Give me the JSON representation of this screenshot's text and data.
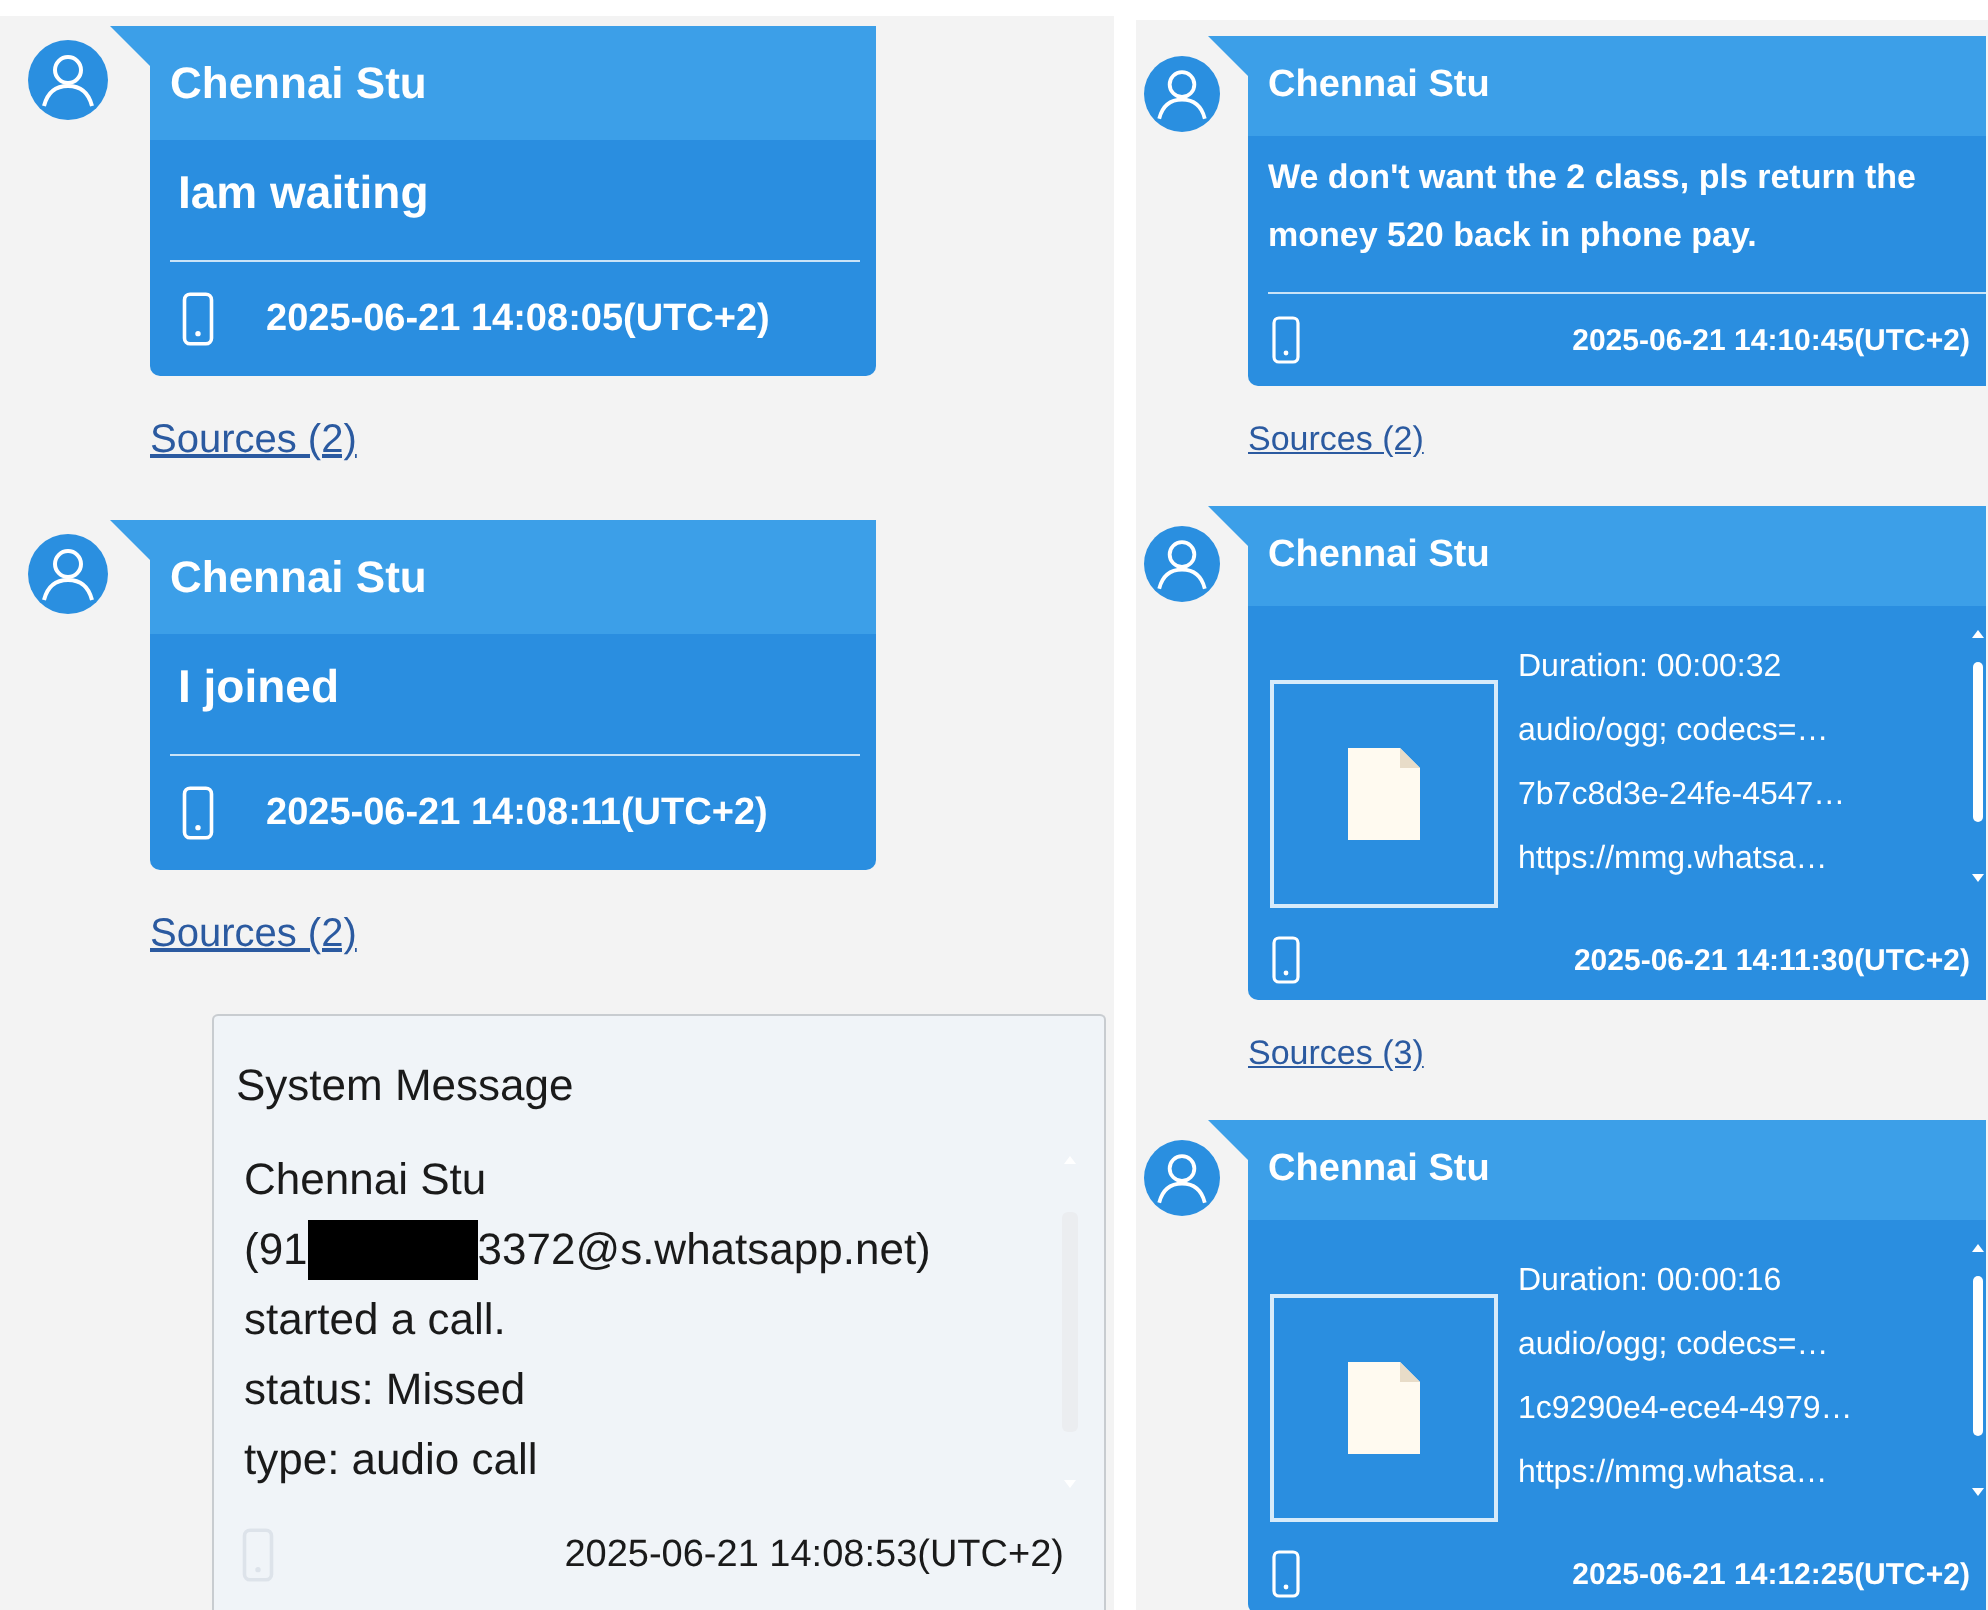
{
  "panes": [
    {
      "messages": [
        {
          "kind": "text",
          "sender": "Chennai Stu",
          "body": "Iam waiting",
          "timestamp": "2025-06-21 14:08:05(UTC+2)",
          "sources": "Sources (2)"
        },
        {
          "kind": "text",
          "sender": "Chennai Stu",
          "body": "I joined",
          "timestamp": "2025-06-21 14:08:11(UTC+2)",
          "sources": "Sources (2)"
        },
        {
          "kind": "system",
          "title": "System Message",
          "lines": [
            {
              "text": "Chennai Stu",
              "redacted": false
            },
            {
              "text": "(91",
              "redacted": true,
              "after": "3372@s.whatsapp.net)"
            },
            {
              "text": "started a call.",
              "redacted": false
            },
            {
              "text": "status: Missed",
              "redacted": false
            },
            {
              "text": "type: audio call",
              "redacted": false
            }
          ],
          "timestamp": "2025-06-21 14:08:53(UTC+2)"
        }
      ]
    },
    {
      "messages": [
        {
          "kind": "text",
          "sender": "Chennai Stu",
          "body": "We don't want the 2 class, pls return the money 520 back in phone pay.",
          "timestamp": "2025-06-21 14:10:45(UTC+2)",
          "sources": "Sources (2)"
        },
        {
          "kind": "attachment",
          "sender": "Chennai Stu",
          "details": [
            "Duration: 00:00:32",
            "audio/ogg; codecs=…",
            "7b7c8d3e-24fe-4547…",
            "https://mmg.whatsa…"
          ],
          "timestamp": "2025-06-21 14:11:30(UTC+2)",
          "sources": "Sources (3)"
        },
        {
          "kind": "attachment",
          "sender": "Chennai Stu",
          "details": [
            "Duration: 00:00:16",
            "audio/ogg; codecs=…",
            "1c9290e4-ece4-4979…",
            "https://mmg.whatsa…"
          ],
          "timestamp": "2025-06-21 14:12:25(UTC+2)"
        }
      ]
    }
  ]
}
